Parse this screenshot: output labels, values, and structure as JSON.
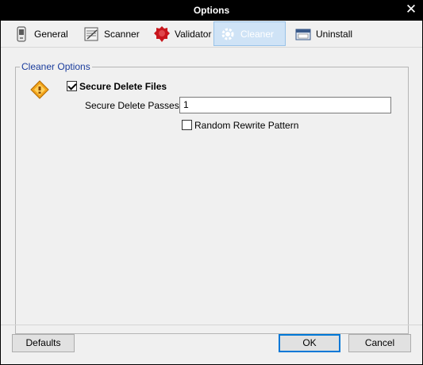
{
  "window": {
    "title": "Options",
    "close_glyph": "✕"
  },
  "tabs": [
    {
      "label": "General",
      "icon": "phone-icon"
    },
    {
      "label": "Scanner",
      "icon": "scanner-icon"
    },
    {
      "label": "Validator",
      "icon": "seal-icon"
    },
    {
      "label": "Cleaner",
      "icon": "gear-icon",
      "active": true
    },
    {
      "label": "Uninstall",
      "icon": "uninstall-icon"
    }
  ],
  "cleaner": {
    "group_title": "Cleaner Options",
    "secure_delete": {
      "label": "Secure Delete Files",
      "checked": true
    },
    "passes": {
      "label": "Secure Delete Passes:",
      "value": "1"
    },
    "random_rewrite": {
      "label": "Random Rewrite Pattern",
      "checked": false
    }
  },
  "buttons": {
    "defaults": "Defaults",
    "ok": "OK",
    "cancel": "Cancel"
  },
  "colors": {
    "accent": "#0078d7",
    "group_title": "#1a3c9c",
    "active_tab": "#cfe3f6"
  }
}
